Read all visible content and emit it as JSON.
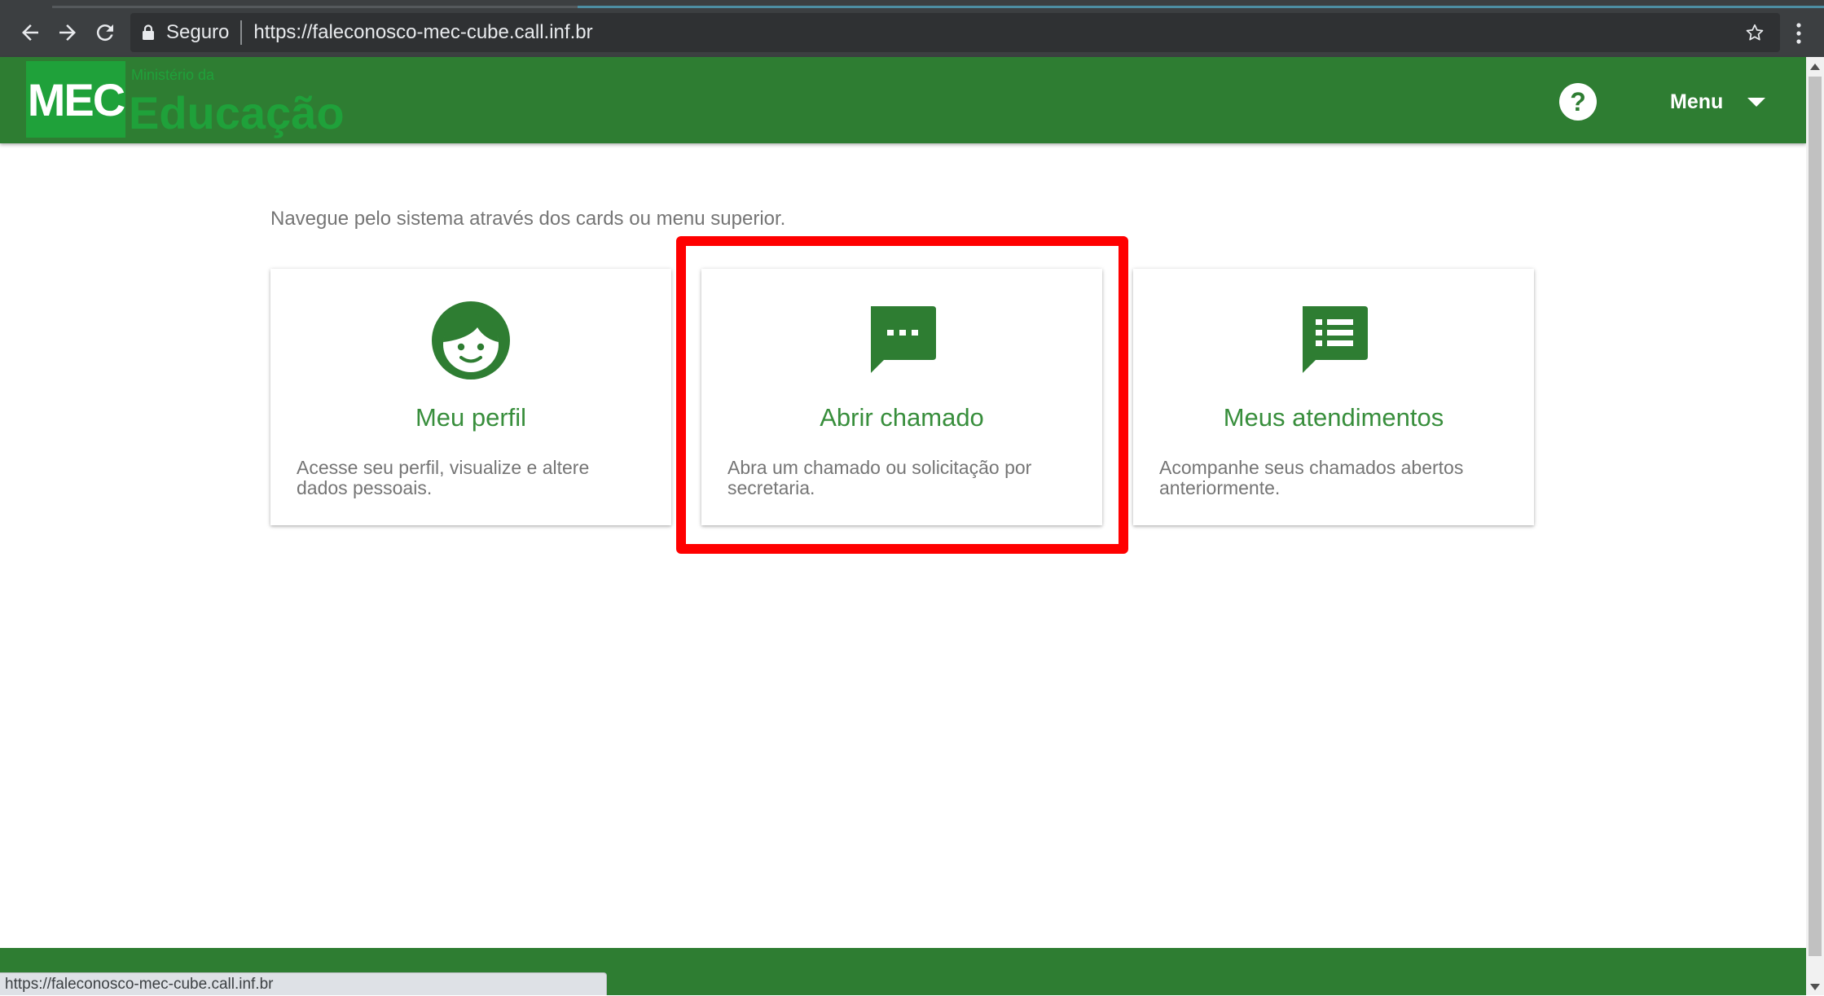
{
  "browser": {
    "secure_label": "Seguro",
    "url": "https://faleconosco-mec-cube.call.inf.br",
    "status_url": "https://faleconosco-mec-cube.call.inf.br",
    "icons": [
      "back-arrow-icon",
      "forward-arrow-icon",
      "reload-icon",
      "lock-icon",
      "star-icon",
      "kebab-menu-icon"
    ]
  },
  "header": {
    "logo_text": "MEC",
    "ministerio": "Ministério da",
    "educacao": "Educação",
    "help_glyph": "?",
    "menu_label": "Menu",
    "colors": {
      "bar": "#2e7d32",
      "logo": "#1fa13a"
    }
  },
  "content": {
    "intro": "Navegue pelo sistema através dos cards ou menu superior.",
    "cards": [
      {
        "icon": "face-icon",
        "title": "Meu perfil",
        "description": "Acesse seu perfil, visualize e altere dados pessoais."
      },
      {
        "icon": "chat-icon",
        "title": "Abrir chamado",
        "description": "Abra um chamado ou solicitação por secretaria."
      },
      {
        "icon": "list-icon",
        "title": "Meus atendimentos",
        "description": "Acompanhe seus chamados abertos anteriormente."
      }
    ],
    "highlight_color": "#ff0000"
  }
}
